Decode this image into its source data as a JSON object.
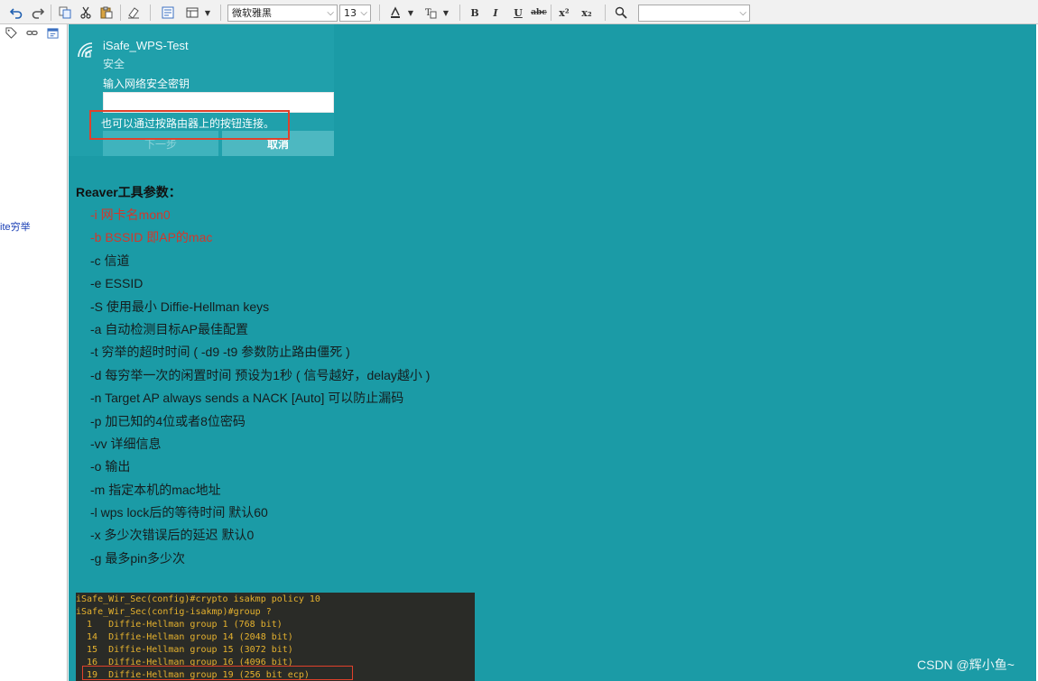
{
  "toolbar": {
    "font_name": "微软雅黑",
    "font_size": "13",
    "search_value": "",
    "format": {
      "bold": "B",
      "italic": "I",
      "underline": "U",
      "strike": "abc",
      "superscript": "x²",
      "subscript": "x₂"
    }
  },
  "sidebar": {
    "text": "ite穷举"
  },
  "wifi": {
    "ssid": "iSafe_WPS-Test",
    "security": "安全",
    "prompt": "输入网络安全密钥",
    "password_value": "",
    "hint": "也可以通过按路由器上的按钮连接。",
    "next_label": "下一步",
    "cancel_label": "取消"
  },
  "params": {
    "title": "Reaver工具参数：",
    "items": [
      {
        "text": "-i  网卡名mon0",
        "red": true
      },
      {
        "text": "-b BSSID 即AP的mac",
        "red": true
      },
      {
        "text": "-c  信道",
        "red": false
      },
      {
        "text": "-e ESSID",
        "red": false
      },
      {
        "text": "-S 使用最小 Diffie-Hellman keys",
        "red": false
      },
      {
        "text": "-a 自动检测目标AP最佳配置",
        "red": false
      },
      {
        "text": "-t  穷举的超时时间    ( -d9 -t9  参数防止路由僵死 )",
        "red": false
      },
      {
        "text": "-d 每穷举一次的闲置时间 预设为1秒  ( 信号越好，delay越小 )",
        "red": false
      },
      {
        "text": "-n Target AP always sends a NACK [Auto]  可以防止漏码",
        "red": false
      },
      {
        "text": "-p 加已知的4位或者8位密码",
        "red": false
      },
      {
        "text": "-vv 详细信息",
        "red": false
      },
      {
        "text": "-o 输出",
        "red": false
      },
      {
        "text": "-m 指定本机的mac地址",
        "red": false
      },
      {
        "text": " -l wps lock后的等待时间 默认60",
        "red": false
      },
      {
        "text": "-x 多少次错误后的延迟 默认0",
        "red": false
      },
      {
        "text": "-g 最多pin多少次",
        "red": false
      }
    ]
  },
  "terminal": {
    "lines": [
      "iSafe_Wir_Sec(config)#crypto isakmp policy 10",
      "iSafe_Wir_Sec(config-isakmp)#group ?",
      "  1   Diffie-Hellman group 1 (768 bit)",
      "  14  Diffie-Hellman group 14 (2048 bit)",
      "  15  Diffie-Hellman group 15 (3072 bit)",
      "  16  Diffie-Hellman group 16 (4096 bit)",
      "  19  Diffie-Hellman group 19 (256 bit ecp)"
    ]
  },
  "watermark": "CSDN @辉小鱼~"
}
